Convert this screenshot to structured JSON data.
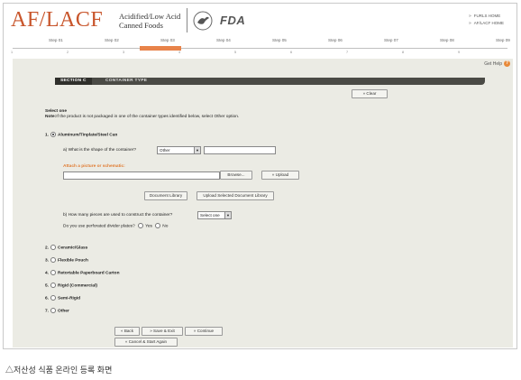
{
  "header": {
    "logo": "AF/LACF",
    "subtitle_line1": "Acidified/Low Acid",
    "subtitle_line2": "Canned Foods",
    "fda_logo": "FDA",
    "links": [
      "FURLS HOME",
      "AF/LACF HOME"
    ]
  },
  "steps": {
    "labels": [
      "Step 01",
      "Step 02",
      "Step 03",
      "Step 04",
      "Step 05",
      "Step 06",
      "Step 07",
      "Step 08",
      "Step 09"
    ],
    "current_label": "",
    "numbers": [
      "1",
      "2",
      "3",
      "4",
      "5",
      "6",
      "7",
      "8",
      "9"
    ]
  },
  "help": {
    "label": "Get Help",
    "icon": "?"
  },
  "section": {
    "tab": "SECTION C",
    "title": "CONTAINER TYPE"
  },
  "buttons": {
    "clear": "Clear",
    "browse": "Browse...",
    "upload": "Upload",
    "document_library": "Document Library",
    "upload_selected": "Upload Selected Document Library",
    "back": "Back",
    "save_exit": "Save & Exit",
    "continue": "Continue",
    "cancel_start": "Cancel & Start Again"
  },
  "instructions": {
    "select_one": "Select one",
    "note_label": "Note:",
    "note_text": "If the product is not packaged in one of the container types identified below, select Other option."
  },
  "options": [
    {
      "num": "1.",
      "label": "Aluminum/Tinplate/Steel Can",
      "selected": true
    },
    {
      "num": "2.",
      "label": "Ceramic/Glass",
      "selected": false
    },
    {
      "num": "3.",
      "label": "Flexible Pouch",
      "selected": false
    },
    {
      "num": "4.",
      "label": "Retortable Paperboard Carton",
      "selected": false
    },
    {
      "num": "5.",
      "label": "Rigid (Commercial)",
      "selected": false
    },
    {
      "num": "6.",
      "label": "Semi-Rigid",
      "selected": false
    },
    {
      "num": "7.",
      "label": "Other",
      "selected": false
    }
  ],
  "subform": {
    "shape_question": "a) What is the shape of the container?",
    "shape_value": "Other",
    "attach_label": "Attach a picture or schematic:",
    "pieces_question": "b) How many pieces are used to construct the container?",
    "pieces_value": "Select one",
    "divider_question": "Do you use perforated divider plates?",
    "divider_yes": "Yes",
    "divider_no": "No"
  },
  "caption": "△저산성 식품 온라인 등록 화면",
  "colors": {
    "logo": "#c8552b",
    "accent": "#e8834a",
    "panel": "#ebebe4",
    "section_bar": "#4a4a45"
  }
}
